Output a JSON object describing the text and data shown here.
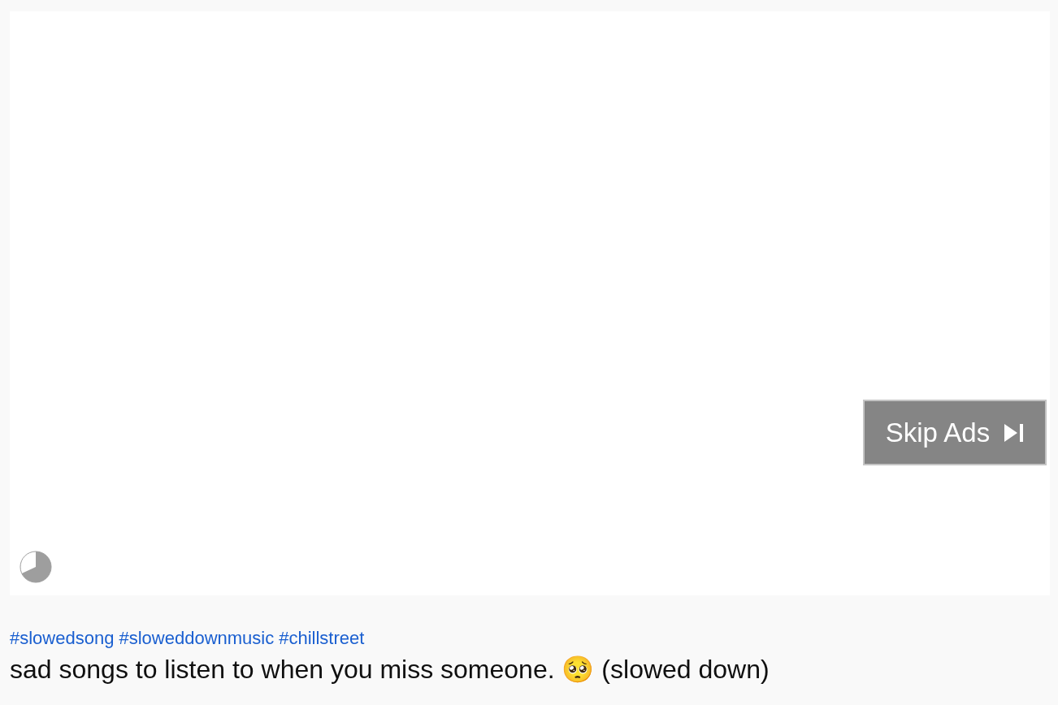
{
  "player": {
    "skip_button": {
      "label": "Skip Ads"
    }
  },
  "hashtags": [
    "#slowedsong",
    "#sloweddownmusic",
    "#chillstreet"
  ],
  "title": "sad songs to listen to when you miss someone. 🥺 (slowed down)"
}
